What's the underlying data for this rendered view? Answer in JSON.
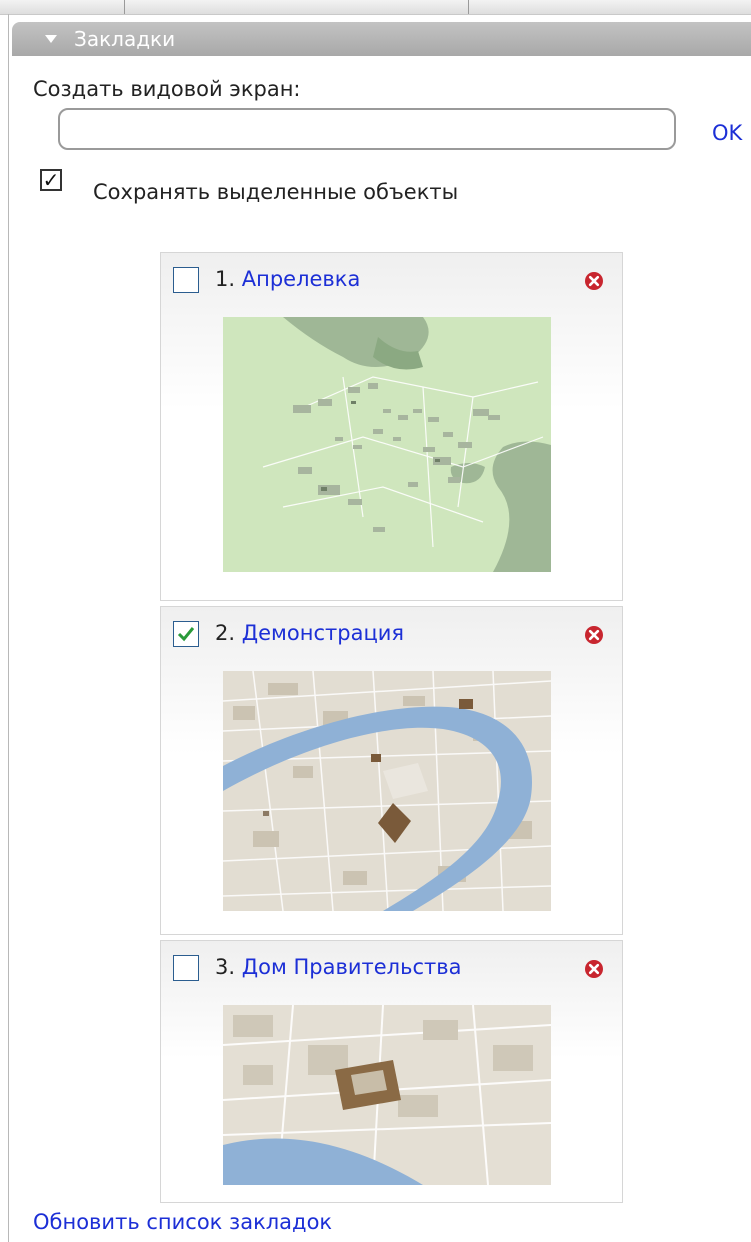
{
  "panel": {
    "title": "Закладки"
  },
  "create": {
    "label": "Создать видовой экран:",
    "input_value": "",
    "ok_label": "OK"
  },
  "keep_selection": {
    "label": "Сохранять выделенные объекты",
    "checked": true
  },
  "bookmarks": [
    {
      "number": "1.",
      "name": "Апрелевка",
      "checked": false,
      "thumbnail": "map-thumbnail-green"
    },
    {
      "number": "2.",
      "name": "Демонстрация",
      "checked": true,
      "thumbnail": "map-thumbnail-river"
    },
    {
      "number": "3.",
      "name": "Дом Правительства",
      "checked": false,
      "thumbnail": "map-thumbnail-government"
    }
  ],
  "refresh_label": "Обновить список закладок",
  "colors": {
    "link": "#1c2fd6",
    "header": "#b5b5b5",
    "check": "#2a9a3a",
    "delete": "#c8262f"
  }
}
